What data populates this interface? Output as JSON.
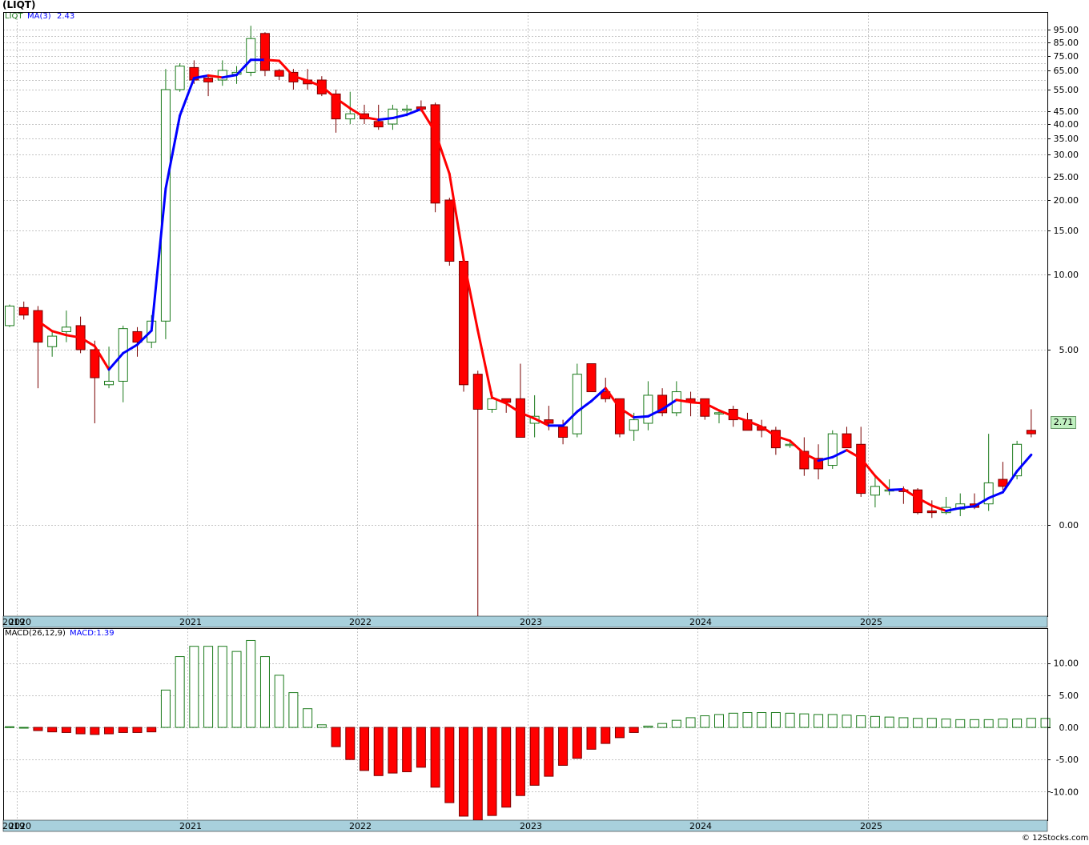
{
  "header": {
    "title": "(LIQT)"
  },
  "footer": {
    "credit": "© 12Stocks.com"
  },
  "price_panel": {
    "legend_symbol": "LIQT",
    "legend_ma_name": "MA(3)",
    "legend_ma_value": "2.43",
    "last_price_tag": "2.71",
    "colors": {
      "up_candle": "#1a7a1a",
      "down_candle": "#ff0000",
      "ma_rising": "#0000ff",
      "ma_falling": "#ff0000",
      "price_tag_bg": "#c0f0c0"
    }
  },
  "macd_panel": {
    "legend_name": "MACD(26,12,9)",
    "legend_value": "MACD:1.39",
    "colors": {
      "positive": "#1a7a1a",
      "negative": "#ff0000"
    }
  },
  "time_axis": {
    "labels": [
      "2019",
      "2020",
      "2021",
      "2022",
      "2023",
      "2024",
      "2025"
    ],
    "label_months": [
      0,
      1,
      13,
      25,
      37,
      49,
      61
    ],
    "color": "#a8d0dc"
  },
  "chart_data": [
    {
      "type": "candlestick",
      "title": "(LIQT)",
      "scale": "log",
      "y_ticks": [
        "95.00",
        "85.00",
        "75.00",
        "65.00",
        "55.00",
        "45.00",
        "40.00",
        "35.00",
        "30.00",
        "25.00",
        "20.00",
        "15.00",
        "10.00",
        "5.00",
        "0.00"
      ],
      "x_labels": [
        "2019",
        "2020",
        "2021",
        "2022",
        "2023",
        "2024",
        "2025"
      ],
      "legend": [
        "LIQT",
        "MA(3) 2.43"
      ],
      "grid": true,
      "candles": [
        {
          "date": "2019-12",
          "open": 6.6,
          "high": 8.0,
          "low": 6.5,
          "close": 7.9
        },
        {
          "date": "2020-01",
          "open": 7.8,
          "high": 8.2,
          "low": 7.0,
          "close": 7.3
        },
        {
          "date": "2020-02",
          "open": 7.6,
          "high": 7.9,
          "low": 3.9,
          "close": 5.5
        },
        {
          "date": "2020-03",
          "open": 5.2,
          "high": 6.3,
          "low": 4.8,
          "close": 5.9
        },
        {
          "date": "2020-04",
          "open": 6.2,
          "high": 7.6,
          "low": 5.5,
          "close": 6.5
        },
        {
          "date": "2020-05",
          "open": 6.6,
          "high": 7.2,
          "low": 4.9,
          "close": 5.0
        },
        {
          "date": "2020-06",
          "open": 5.0,
          "high": 5.6,
          "low": 2.9,
          "close": 4.2
        },
        {
          "date": "2020-07",
          "open": 4.0,
          "high": 5.2,
          "low": 3.9,
          "close": 4.1
        },
        {
          "date": "2020-08",
          "open": 4.1,
          "high": 6.6,
          "low": 3.5,
          "close": 6.4
        },
        {
          "date": "2020-09",
          "open": 6.2,
          "high": 6.5,
          "low": 4.8,
          "close": 5.5
        },
        {
          "date": "2020-10",
          "open": 5.5,
          "high": 7.3,
          "low": 5.1,
          "close": 6.9
        },
        {
          "date": "2020-11",
          "open": 6.9,
          "high": 66,
          "low": 5.7,
          "close": 55
        },
        {
          "date": "2020-12",
          "open": 55,
          "high": 70,
          "low": 54,
          "close": 68
        },
        {
          "date": "2021-01",
          "open": 67,
          "high": 72,
          "low": 58,
          "close": 60
        },
        {
          "date": "2021-02",
          "open": 61,
          "high": 63,
          "low": 52,
          "close": 59
        },
        {
          "date": "2021-03",
          "open": 60,
          "high": 72,
          "low": 57,
          "close": 65
        },
        {
          "date": "2021-04",
          "open": 63,
          "high": 68,
          "low": 58,
          "close": 64
        },
        {
          "date": "2021-05",
          "open": 64,
          "high": 98,
          "low": 62,
          "close": 88
        },
        {
          "date": "2021-06",
          "open": 92,
          "high": 93,
          "low": 62,
          "close": 65
        },
        {
          "date": "2021-07",
          "open": 65,
          "high": 66,
          "low": 60,
          "close": 62
        },
        {
          "date": "2021-08",
          "open": 64,
          "high": 66,
          "low": 55,
          "close": 59
        },
        {
          "date": "2021-09",
          "open": 60,
          "high": 66,
          "low": 55,
          "close": 58
        },
        {
          "date": "2021-10",
          "open": 60,
          "high": 62,
          "low": 52,
          "close": 53
        },
        {
          "date": "2021-11",
          "open": 53,
          "high": 55,
          "low": 37,
          "close": 42
        },
        {
          "date": "2021-12",
          "open": 42,
          "high": 54,
          "low": 40,
          "close": 44
        },
        {
          "date": "2022-01",
          "open": 44,
          "high": 48,
          "low": 40,
          "close": 42
        },
        {
          "date": "2022-02",
          "open": 41,
          "high": 48,
          "low": 38,
          "close": 39
        },
        {
          "date": "2022-03",
          "open": 40,
          "high": 48,
          "low": 38,
          "close": 46
        },
        {
          "date": "2022-04",
          "open": 46,
          "high": 48,
          "low": 43,
          "close": 46
        },
        {
          "date": "2022-05",
          "open": 47,
          "high": 50,
          "low": 45,
          "close": 46
        },
        {
          "date": "2022-06",
          "open": 48,
          "high": 49,
          "low": 18,
          "close": 19.5
        },
        {
          "date": "2022-07",
          "open": 20,
          "high": 20.5,
          "low": 11,
          "close": 11.5
        },
        {
          "date": "2022-08",
          "open": 11.5,
          "high": 11.8,
          "low": 3.8,
          "close": 4.0
        },
        {
          "date": "2022-09",
          "open": 4.3,
          "high": 4.4,
          "low": -7.0,
          "close": 3.3
        },
        {
          "date": "2022-10",
          "open": 3.3,
          "high": 3.8,
          "low": 3.2,
          "close": 3.6
        },
        {
          "date": "2022-11",
          "open": 3.6,
          "high": 3.6,
          "low": 3.2,
          "close": 3.5
        },
        {
          "date": "2022-12",
          "open": 3.6,
          "high": 4.6,
          "low": 2.5,
          "close": 2.5
        },
        {
          "date": "2023-01",
          "open": 2.9,
          "high": 3.7,
          "low": 2.5,
          "close": 3.1
        },
        {
          "date": "2023-02",
          "open": 3.0,
          "high": 3.4,
          "low": 2.7,
          "close": 2.9
        },
        {
          "date": "2023-03",
          "open": 2.8,
          "high": 3.0,
          "low": 2.3,
          "close": 2.5
        },
        {
          "date": "2023-04",
          "open": 2.6,
          "high": 4.6,
          "low": 2.5,
          "close": 4.3
        },
        {
          "date": "2023-05",
          "open": 4.6,
          "high": 4.6,
          "low": 3.8,
          "close": 3.8
        },
        {
          "date": "2023-06",
          "open": 3.8,
          "high": 4.2,
          "low": 3.5,
          "close": 3.6
        },
        {
          "date": "2023-07",
          "open": 3.6,
          "high": 3.6,
          "low": 2.5,
          "close": 2.6
        },
        {
          "date": "2023-08",
          "open": 2.7,
          "high": 3.2,
          "low": 2.4,
          "close": 3.0
        },
        {
          "date": "2023-09",
          "open": 2.9,
          "high": 4.1,
          "low": 2.7,
          "close": 3.7
        },
        {
          "date": "2023-10",
          "open": 3.7,
          "high": 3.9,
          "low": 3.1,
          "close": 3.2
        },
        {
          "date": "2023-11",
          "open": 3.2,
          "high": 4.1,
          "low": 3.1,
          "close": 3.8
        },
        {
          "date": "2023-12",
          "open": 3.6,
          "high": 3.8,
          "low": 3.1,
          "close": 3.5
        },
        {
          "date": "2024-01",
          "open": 3.6,
          "high": 3.6,
          "low": 3.0,
          "close": 3.1
        },
        {
          "date": "2024-02",
          "open": 3.2,
          "high": 3.3,
          "low": 2.9,
          "close": 3.2
        },
        {
          "date": "2024-03",
          "open": 3.3,
          "high": 3.4,
          "low": 2.8,
          "close": 3.0
        },
        {
          "date": "2024-04",
          "open": 3.0,
          "high": 3.2,
          "low": 2.8,
          "close": 2.7
        },
        {
          "date": "2024-05",
          "open": 2.8,
          "high": 3.0,
          "low": 2.5,
          "close": 2.7
        },
        {
          "date": "2024-06",
          "open": 2.7,
          "high": 2.8,
          "low": 2.0,
          "close": 2.2
        },
        {
          "date": "2024-07",
          "open": 2.3,
          "high": 2.4,
          "low": 2.2,
          "close": 2.3
        },
        {
          "date": "2024-08",
          "open": 2.1,
          "high": 2.5,
          "low": 1.4,
          "close": 1.6
        },
        {
          "date": "2024-09",
          "open": 1.9,
          "high": 2.3,
          "low": 1.3,
          "close": 1.6
        },
        {
          "date": "2024-10",
          "open": 1.7,
          "high": 2.7,
          "low": 1.6,
          "close": 2.6
        },
        {
          "date": "2024-11",
          "open": 2.6,
          "high": 2.8,
          "low": 2.3,
          "close": 2.2
        },
        {
          "date": "2024-12",
          "open": 2.3,
          "high": 2.8,
          "low": 0.8,
          "close": 0.9
        },
        {
          "date": "2025-01",
          "open": 0.85,
          "high": 1.4,
          "low": 0.5,
          "close": 1.1
        },
        {
          "date": "2025-02",
          "open": 1.0,
          "high": 1.3,
          "low": 0.85,
          "close": 1.0
        },
        {
          "date": "2025-03",
          "open": 1.0,
          "high": 1.1,
          "low": 0.6,
          "close": 0.95
        },
        {
          "date": "2025-04",
          "open": 1.0,
          "high": 1.05,
          "low": 0.3,
          "close": 0.35
        },
        {
          "date": "2025-05",
          "open": 0.4,
          "high": 0.7,
          "low": 0.2,
          "close": 0.35
        },
        {
          "date": "2025-06",
          "open": 0.35,
          "high": 0.8,
          "low": 0.3,
          "close": 0.5
        },
        {
          "date": "2025-07",
          "open": 0.45,
          "high": 0.9,
          "low": 0.25,
          "close": 0.6
        },
        {
          "date": "2025-08",
          "open": 0.6,
          "high": 0.9,
          "low": 0.45,
          "close": 0.5
        },
        {
          "date": "2025-09",
          "open": 0.6,
          "high": 2.6,
          "low": 0.4,
          "close": 1.2
        },
        {
          "date": "2025-10",
          "open": 1.3,
          "high": 1.8,
          "low": 1.0,
          "close": 1.1
        },
        {
          "date": "2025-11",
          "open": 1.4,
          "high": 2.4,
          "low": 1.3,
          "close": 2.3
        },
        {
          "date": "2025-12",
          "open": 2.7,
          "high": 3.3,
          "low": 2.5,
          "close": 2.6
        }
      ]
    },
    {
      "type": "bar",
      "title": "MACD(26,12,9)",
      "y_ticks": [
        "10.00",
        "5.00",
        "0.00",
        "-5.00",
        "-10.00"
      ],
      "x_labels": [
        "2019",
        "2020",
        "2021",
        "2022",
        "2023",
        "2024",
        "2025"
      ],
      "legend": [
        "MACD(26,12,9)",
        "MACD:1.39"
      ],
      "grid": true,
      "values": [
        0.1,
        0.0,
        -0.5,
        -0.7,
        -0.8,
        -1.0,
        -1.1,
        -1.0,
        -0.8,
        -0.8,
        -0.7,
        5.8,
        11.0,
        12.6,
        12.6,
        12.6,
        11.8,
        13.5,
        11.0,
        8.1,
        5.4,
        2.9,
        0.4,
        -3.0,
        -5.0,
        -6.7,
        -7.5,
        -7.1,
        -6.9,
        -6.2,
        -9.3,
        -11.7,
        -13.8,
        -14.5,
        -13.7,
        -12.4,
        -10.6,
        -9.0,
        -7.6,
        -5.9,
        -4.8,
        -3.4,
        -2.5,
        -1.6,
        -0.8,
        0.2,
        0.6,
        1.1,
        1.5,
        1.8,
        2.0,
        2.2,
        2.3,
        2.3,
        2.3,
        2.2,
        2.1,
        2.0,
        2.0,
        1.9,
        1.8,
        1.7,
        1.6,
        1.5,
        1.4,
        1.4,
        1.3,
        1.2,
        1.2,
        1.2,
        1.3,
        1.3,
        1.4,
        1.39
      ]
    }
  ]
}
